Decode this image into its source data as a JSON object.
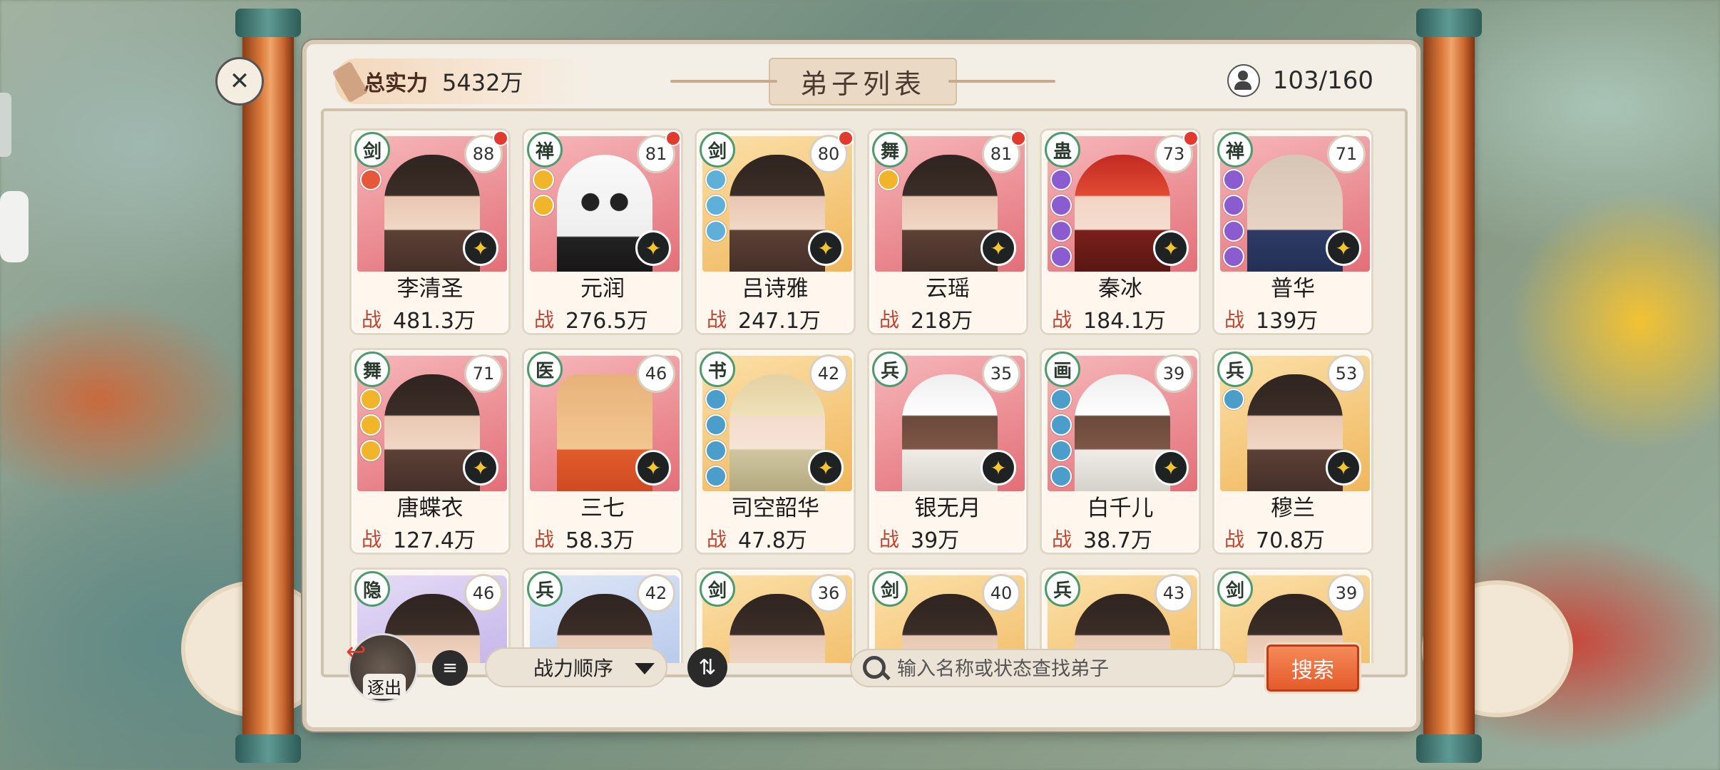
{
  "header": {
    "total_power_label": "总实力",
    "total_power_value": "5432万",
    "title": "弟子列表",
    "disciple_count": "103/160"
  },
  "colors": {
    "accent_orange": "#e4582a",
    "power_red": "#c0432f",
    "panel_bg": "#f4efe6"
  },
  "disciples": [
    {
      "sect": "剑",
      "level": "88",
      "name": "李清圣",
      "power_label": "战",
      "power": "481.3万",
      "new": true,
      "bg": "bg-pink",
      "hair": "",
      "dots": [
        "#e5583a"
      ]
    },
    {
      "sect": "禅",
      "level": "81",
      "name": "元润",
      "power_label": "战",
      "power": "276.5万",
      "new": true,
      "bg": "bg-pink",
      "hair": "panda",
      "dots": [
        "#f0b52b",
        "#f0b52b"
      ]
    },
    {
      "sect": "剑",
      "level": "80",
      "name": "吕诗雅",
      "power_label": "战",
      "power": "247.1万",
      "new": true,
      "bg": "bg-gold",
      "hair": "",
      "dots": [
        "#5fb0d8",
        "#5fb0d8",
        "#5fb0d8"
      ]
    },
    {
      "sect": "舞",
      "level": "81",
      "name": "云瑶",
      "power_label": "战",
      "power": "218万",
      "new": true,
      "bg": "bg-pink",
      "hair": "",
      "dots": [
        "#f0b52b"
      ]
    },
    {
      "sect": "蛊",
      "level": "73",
      "name": "秦冰",
      "power_label": "战",
      "power": "184.1万",
      "new": true,
      "bg": "bg-pink",
      "hair": "hair-red",
      "dots": [
        "#8b5bd0",
        "#8b5bd0",
        "#8b5bd0",
        "#8b5bd0"
      ]
    },
    {
      "sect": "禅",
      "level": "71",
      "name": "普华",
      "power_label": "战",
      "power": "139万",
      "new": false,
      "bg": "bg-pink",
      "hair": "hair-bald",
      "dots": [
        "#8b5bd0",
        "#8b5bd0",
        "#8b5bd0",
        "#8b5bd0"
      ]
    },
    {
      "sect": "舞",
      "level": "71",
      "name": "唐蝶衣",
      "power_label": "战",
      "power": "127.4万",
      "new": false,
      "bg": "bg-pink",
      "hair": "",
      "dots": [
        "#f0b52b",
        "#f0b52b",
        "#f0b52b"
      ]
    },
    {
      "sect": "医",
      "level": "46",
      "name": "三七",
      "power_label": "战",
      "power": "58.3万",
      "new": false,
      "bg": "bg-pink",
      "hair": "cat",
      "dots": []
    },
    {
      "sect": "书",
      "level": "42",
      "name": "司空韶华",
      "power_label": "战",
      "power": "47.8万",
      "new": false,
      "bg": "bg-gold",
      "hair": "hair-blond",
      "dots": [
        "#4a9ec9",
        "#4a9ec9",
        "#4a9ec9",
        "#4a9ec9"
      ]
    },
    {
      "sect": "兵",
      "level": "35",
      "name": "银无月",
      "power_label": "战",
      "power": "39万",
      "new": false,
      "bg": "bg-pink",
      "hair": "hair-white",
      "dots": []
    },
    {
      "sect": "画",
      "level": "39",
      "name": "白千儿",
      "power_label": "战",
      "power": "38.7万",
      "new": false,
      "bg": "bg-pink",
      "hair": "hair-white",
      "dots": [
        "#4a9ec9",
        "#4a9ec9",
        "#4a9ec9",
        "#4a9ec9"
      ]
    },
    {
      "sect": "兵",
      "level": "53",
      "name": "穆兰",
      "power_label": "战",
      "power": "70.8万",
      "new": false,
      "bg": "bg-gold",
      "hair": "",
      "dots": [
        "#4a9ec9"
      ]
    },
    {
      "sect": "隐",
      "level": "46",
      "name": "",
      "power_label": "",
      "power": "",
      "new": false,
      "bg": "bg-lilac",
      "hair": "",
      "dots": []
    },
    {
      "sect": "兵",
      "level": "42",
      "name": "",
      "power_label": "",
      "power": "",
      "new": false,
      "bg": "bg-blue",
      "hair": "",
      "dots": []
    },
    {
      "sect": "剑",
      "level": "36",
      "name": "",
      "power_label": "",
      "power": "",
      "new": false,
      "bg": "bg-gold",
      "hair": "",
      "dots": []
    },
    {
      "sect": "剑",
      "level": "40",
      "name": "",
      "power_label": "",
      "power": "",
      "new": false,
      "bg": "bg-gold",
      "hair": "",
      "dots": []
    },
    {
      "sect": "兵",
      "level": "43",
      "name": "",
      "power_label": "",
      "power": "",
      "new": false,
      "bg": "bg-gold",
      "hair": "",
      "dots": []
    },
    {
      "sect": "剑",
      "level": "39",
      "name": "",
      "power_label": "",
      "power": "",
      "new": false,
      "bg": "bg-gold",
      "hair": "",
      "dots": []
    }
  ],
  "toolbar": {
    "exit_label": "逐出",
    "sort_label": "战力顺序",
    "search_placeholder": "输入名称或状态查找弟子",
    "search_button": "搜索"
  },
  "icons": {
    "scroll_knot": "✕",
    "list": "≡",
    "swap": "⇅",
    "star": "✦",
    "exit_arrow": "↩"
  }
}
